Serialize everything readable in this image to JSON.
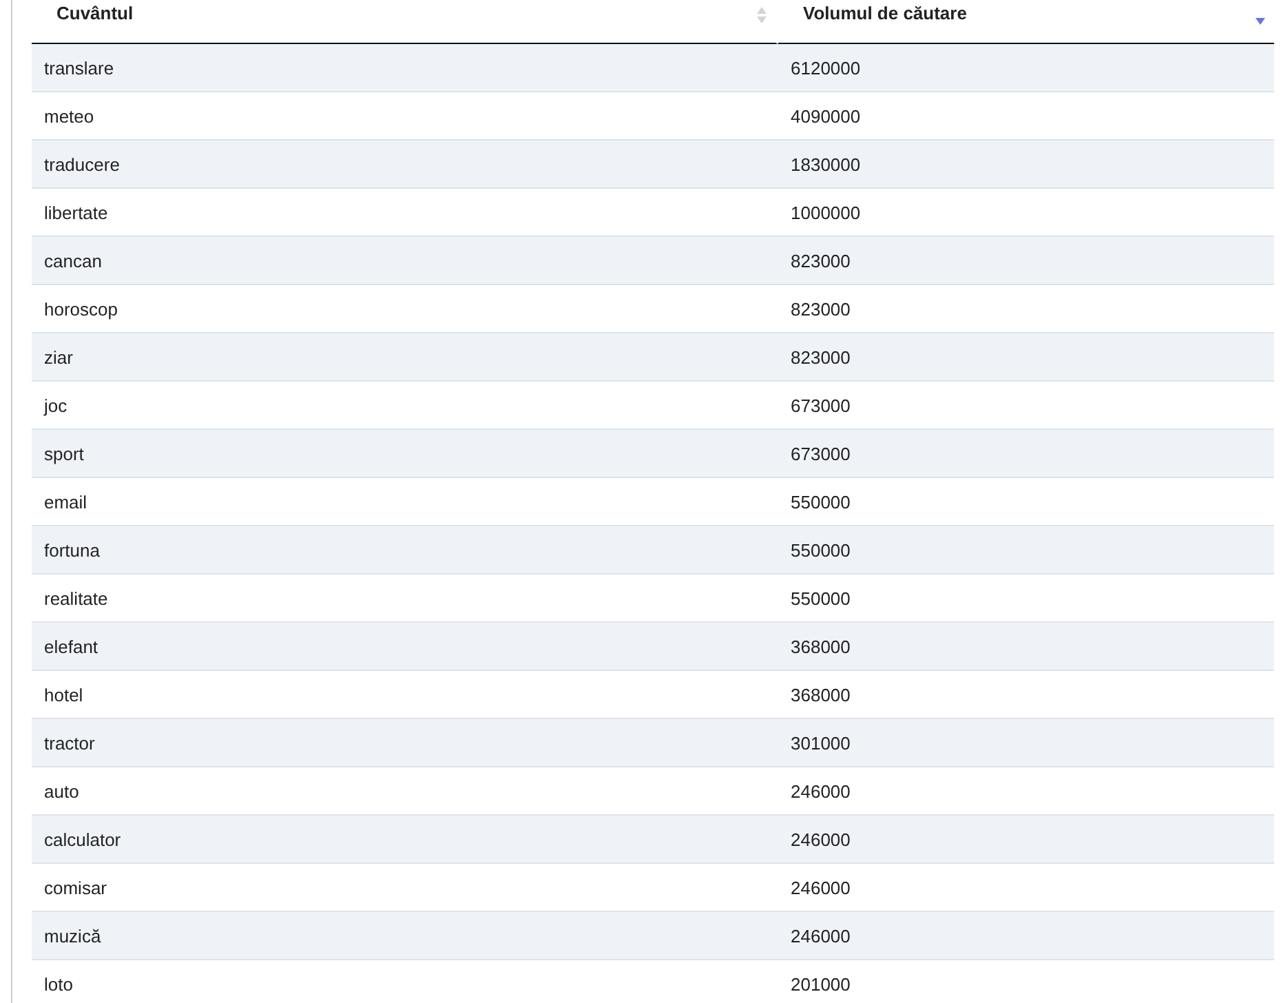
{
  "table": {
    "columns": [
      {
        "label": "Cuvântul",
        "sorted": false
      },
      {
        "label": "Volumul de căutare",
        "sorted": true,
        "descending": true
      }
    ],
    "rows": [
      [
        "translare",
        "6120000"
      ],
      [
        "meteo",
        "4090000"
      ],
      [
        "traducere",
        "1830000"
      ],
      [
        "libertate",
        "1000000"
      ],
      [
        "cancan",
        "823000"
      ],
      [
        "horoscop",
        "823000"
      ],
      [
        "ziar",
        "823000"
      ],
      [
        "joc",
        "673000"
      ],
      [
        "sport",
        "673000"
      ],
      [
        "email",
        "550000"
      ],
      [
        "fortuna",
        "550000"
      ],
      [
        "realitate",
        "550000"
      ],
      [
        "elefant",
        "368000"
      ],
      [
        "hotel",
        "368000"
      ],
      [
        "tractor",
        "301000"
      ],
      [
        "auto",
        "246000"
      ],
      [
        "calculator",
        "246000"
      ],
      [
        "comisar",
        "246000"
      ],
      [
        "muzică",
        "246000"
      ],
      [
        "loto",
        "201000"
      ]
    ]
  }
}
